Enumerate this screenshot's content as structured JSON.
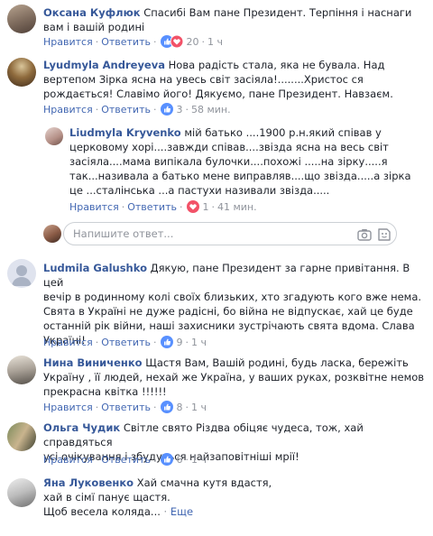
{
  "comments": [
    {
      "author": "Оксана Куфлюк",
      "lines": [
        "Спасибі Вам пане Президент. Терпіння і наснаги",
        "вам і вашій родині"
      ],
      "like": "Нравится",
      "reply": "Ответить",
      "reactions": "20",
      "time": "1 ч"
    },
    {
      "author": "Lyudmyla Andreyeva",
      "lines": [
        "Нова радість стала, яка не бувала. Над",
        "вертепом Зірка ясна на увесь світ засіяла!........Христос ся",
        "рождається! Славімо його! Дякуємо, пане Президент. Навзаєм."
      ],
      "like": "Нравится",
      "reply": "Ответить",
      "reactions": "3",
      "time": "58 мин."
    },
    {
      "author": "Liudmyla Kryvenko",
      "lines": [
        "мій батько ....1900 р.н.який співав у",
        "церковому хорі....завжди співав....звізда ясна на весь світ",
        "засіяла....мама випікала булочки....похожі .....на зірку.....я",
        "так...називала а батько мене виправляв....що звізда.....а зірка",
        "це ...сталінська ...а пастухи називали звізда....."
      ],
      "like": "Нравится",
      "reply": "Ответить",
      "reactions": "1",
      "time": "41 мин."
    },
    {
      "author": "Ludmila Galushko",
      "lines": [
        "Дякую, пане Президент за гарне привітання. В цей",
        "вечір в родинному колі своїх близьких, хто згадують кого вже нема.",
        "Свята в Україні не дуже радісні, бо війна не відпускає, хай це буде",
        "останній рік війни, наші захисники зустрічають свята вдома. Слава",
        "Україні!"
      ],
      "like": "Нравится",
      "reply": "Ответить",
      "reactions": "9",
      "time": "1 ч"
    },
    {
      "author": "Нина Виниченко",
      "lines": [
        "Щастя Вам, Вашій родині, будь ласка, бережіть",
        "Україну , її людей, нехай же Україна, у ваших руках, розквітне немов",
        "прекрасна квітка !!!!!!"
      ],
      "like": "Нравится",
      "reply": "Ответить",
      "reactions": "8",
      "time": "1 ч"
    },
    {
      "author": "Ольга Чудик",
      "lines": [
        "Світле свято Різдва обіцяє чудеса, тож, хай справдяться",
        "усі очікування і збудуться найзаповітніші мрії!"
      ],
      "like": "Нравится",
      "reply": "Ответить",
      "reactions": "6",
      "time": "1 ч"
    },
    {
      "author": "Яна Луковенко",
      "lines": [
        "Хай смачна кутя вдастя,",
        "хай в сімї панує щастя.",
        "Щоб весела коляда..."
      ],
      "more": "Еще"
    }
  ],
  "reply_box": {
    "placeholder": "Напишите ответ..."
  },
  "colors": {
    "link": "#4267b2",
    "author": "#365899",
    "muted": "#90949c",
    "like_blue": "#5890ff",
    "love_red": "#f25268"
  },
  "icons": {
    "like": "thumbs-up-icon",
    "love": "heart-icon",
    "camera": "camera-icon",
    "sticker": "sticker-icon"
  }
}
